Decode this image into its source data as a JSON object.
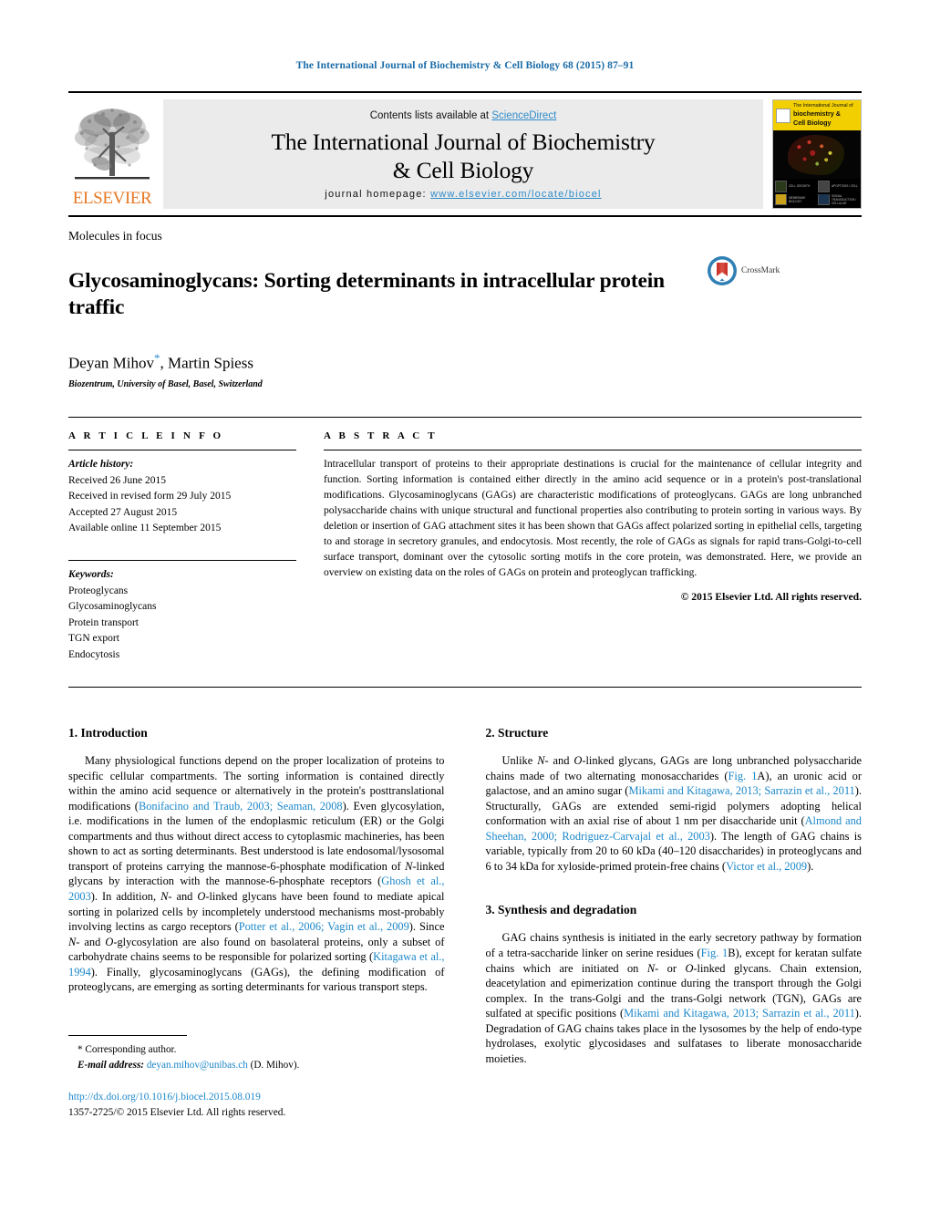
{
  "running_head": "The International Journal of Biochemistry & Cell Biology 68 (2015) 87–91",
  "masthead": {
    "contents_prefix": "Contents lists available at ",
    "sciencedirect": "ScienceDirect",
    "journal_title_line1": "The International Journal of Biochemistry",
    "journal_title_line2": "& Cell Biology",
    "homepage_prefix": "journal homepage: ",
    "homepage_url": "www.elsevier.com/locate/biocel",
    "elsevier_wordmark": "ELSEVIER",
    "cover": {
      "band_small": "The International Journal of",
      "band_line1": "biochemistry &",
      "band_line2": "Cell Biology",
      "thumb_captions": [
        "CELL GROWTH",
        "APOPTOSIS / CELL",
        "MEMBRANE BIOLOGY",
        "SIGNAL TRANSDUCTION / CELLULAR"
      ]
    }
  },
  "article": {
    "category": "Molecules in focus",
    "title": "Glycosaminoglycans: Sorting determinants in intracellular protein traffic",
    "authors": "Deyan Mihov",
    "authors_rest": ", Martin Spiess",
    "corresponding_marker": "*",
    "affiliation": "Biozentrum, University of Basel, Basel, Switzerland",
    "crossmark_label": "CrossMark"
  },
  "info": {
    "heading": "A R T I C L E    I N F O",
    "history_label": "Article history:",
    "history": [
      "Received 26 June 2015",
      "Received in revised form 29 July 2015",
      "Accepted 27 August 2015",
      "Available online 11 September 2015"
    ],
    "keywords_label": "Keywords:",
    "keywords": [
      "Proteoglycans",
      "Glycosaminoglycans",
      "Protein transport",
      "TGN export",
      "Endocytosis"
    ]
  },
  "abstract": {
    "heading": "A B S T R A C T",
    "text": "Intracellular transport of proteins to their appropriate destinations is crucial for the maintenance of cellular integrity and function. Sorting information is contained either directly in the amino acid sequence or in a protein's post-translational modifications. Glycosaminoglycans (GAGs) are characteristic modifications of proteoglycans. GAGs are long unbranched polysaccharide chains with unique structural and functional properties also contributing to protein sorting in various ways. By deletion or insertion of GAG attachment sites it has been shown that GAGs affect polarized sorting in epithelial cells, targeting to and storage in secretory granules, and endocytosis. Most recently, the role of GAGs as signals for rapid trans-Golgi-to-cell surface transport, dominant over the cytosolic sorting motifs in the core protein, was demonstrated. Here, we provide an overview on existing data on the roles of GAGs on protein and proteoglycan trafficking.",
    "copyright": "© 2015 Elsevier Ltd. All rights reserved."
  },
  "sections": {
    "introduction": {
      "heading": "1.  Introduction",
      "p1_a": "Many physiological functions depend on the proper localization of proteins to specific cellular compartments. The sorting information is contained directly within the amino acid sequence or alternatively in the protein's posttranslational modifications (",
      "p1_ref1": "Bonifacino and Traub, 2003; Seaman, 2008",
      "p1_b": "). Even glycosylation, i.e. modifications in the lumen of the endoplasmic reticulum (ER) or the Golgi compartments and thus without direct access to cytoplasmic machineries, has been shown to act as sorting determinants. Best understood is late endosomal/lysosomal transport of proteins carrying the mannose-6-phosphate modification of ",
      "p1_it1": "N",
      "p1_c": "-linked glycans by interaction with the mannose-6-phosphate receptors (",
      "p1_ref2": "Ghosh et al., 2003",
      "p1_d": "). In addition, ",
      "p1_it2": "N",
      "p1_e": "- and ",
      "p1_it3": "O",
      "p1_f": "-linked glycans have been found to mediate apical sorting in polarized cells by incompletely understood mechanisms most-probably involving lectins as cargo receptors (",
      "p1_ref3": "Potter et al., 2006; Vagin et al., 2009",
      "p1_g": "). Since ",
      "p1_it4": "N",
      "p1_h": "- and ",
      "p1_it5": "O",
      "p1_i": "-glycosylation are also found on basolateral proteins, only a subset of carbohydrate chains seems to be responsible for polarized sorting (",
      "p1_ref4": "Kitagawa et al., 1994",
      "p1_j": "). Finally, glycosaminoglycans (GAGs), the defining modification of proteoglycans, are emerging as sorting determinants for various transport steps."
    },
    "structure": {
      "heading": "2.  Structure",
      "p1_a": "Unlike ",
      "p1_it1": "N",
      "p1_b": "- and ",
      "p1_it2": "O",
      "p1_c": "-linked glycans, GAGs are long unbranched polysaccharide chains made of two alternating monosaccharides (",
      "p1_ref1": "Fig. 1",
      "p1_d": "A), an uronic acid or galactose, and an amino sugar (",
      "p1_ref2": "Mikami and Kitagawa, 2013; Sarrazin et al., 2011",
      "p1_e": "). Structurally, GAGs are extended semi-rigid polymers adopting helical conformation with an axial rise of about 1 nm per disaccharide unit (",
      "p1_ref3": "Almond and Sheehan, 2000; Rodriguez-Carvajal et al., 2003",
      "p1_f": "). The length of GAG chains is variable, typically from 20 to 60 kDa (40–120 disaccharides) in proteoglycans and 6 to 34 kDa for xyloside-primed protein-free chains (",
      "p1_ref4": "Victor et al., 2009",
      "p1_g": ")."
    },
    "synthesis": {
      "heading": "3.  Synthesis and degradation",
      "p1_a": "GAG chains synthesis is initiated in the early secretory pathway by formation of a tetra-saccharide linker on serine residues (",
      "p1_ref1": "Fig. 1",
      "p1_b": "B), except for keratan sulfate chains which are initiated on ",
      "p1_it1": "N",
      "p1_c": "- or ",
      "p1_it2": "O",
      "p1_d": "-linked glycans. Chain extension, deacetylation and epimerization continue during the transport through the Golgi complex. In the trans-Golgi and the trans-Golgi network (TGN), GAGs are sulfated at specific positions (",
      "p1_ref2": "Mikami and Kitagawa, 2013; Sarrazin et al., 2011",
      "p1_e": "). Degradation of GAG chains takes place in the lysosomes by the help of endo-type hydrolases, exolytic glycosidases and sulfatases to liberate monosaccharide moieties."
    }
  },
  "footer": {
    "corresponding_marker": "*",
    "corresponding_text": "Corresponding author.",
    "email_label": "E-mail address:",
    "email": "deyan.mihov@unibas.ch",
    "email_suffix": "(D. Mihov).",
    "doi": "http://dx.doi.org/10.1016/j.biocel.2015.08.019",
    "issn_line": "1357-2725/© 2015 Elsevier Ltd. All rights reserved."
  },
  "colors": {
    "link_blue": "#1b87c9",
    "header_blue": "#1b6ca8",
    "elsevier_orange": "#E87722",
    "cover_yellow": "#f2cf00"
  }
}
